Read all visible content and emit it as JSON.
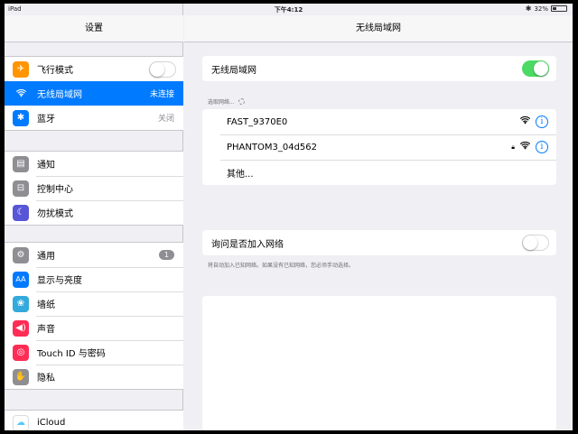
{
  "status_bar": {
    "carrier": "iPad",
    "time": "下午4:12",
    "battery": "32%",
    "battery_level": 0.32
  },
  "sidebar": {
    "title": "设置",
    "group1": [
      {
        "label": "飞行模式",
        "icon": "airplane-icon",
        "color": "#ff9500",
        "toggle": false
      },
      {
        "label": "无线局域网",
        "icon": "wifi-icon",
        "color": "#007aff",
        "value": "未连接",
        "selected": true
      },
      {
        "label": "蓝牙",
        "icon": "bluetooth-icon",
        "color": "#007aff",
        "value": "关闭"
      }
    ],
    "group2": [
      {
        "label": "通知",
        "icon": "notifications-icon",
        "color": "#8e8e93"
      },
      {
        "label": "控制中心",
        "icon": "control-center-icon",
        "color": "#8e8e93"
      },
      {
        "label": "勿扰模式",
        "icon": "moon-icon",
        "color": "#5856d6"
      }
    ],
    "group3": [
      {
        "label": "通用",
        "icon": "gear-icon",
        "color": "#8e8e93",
        "badge": "1"
      },
      {
        "label": "显示与亮度",
        "icon": "display-icon",
        "color": "#007aff"
      },
      {
        "label": "墙纸",
        "icon": "wallpaper-icon",
        "color": "#34aadc"
      },
      {
        "label": "声音",
        "icon": "sound-icon",
        "color": "#ff2d55"
      },
      {
        "label": "Touch ID 与密码",
        "icon": "fingerprint-icon",
        "color": "#ff2d55"
      },
      {
        "label": "隐私",
        "icon": "hand-icon",
        "color": "#8e8e93"
      }
    ],
    "group4": [
      {
        "label": "iCloud",
        "icon": "cloud-icon",
        "color": "#ffffff"
      }
    ]
  },
  "main": {
    "title": "无线局域网",
    "wifi_toggle_label": "无线局域网",
    "wifi_on": true,
    "choose_network_label": "选取网络...",
    "networks": [
      {
        "name": "FAST_9370E0",
        "locked": false
      },
      {
        "name": "PHANTOM3_04d562",
        "locked": true
      }
    ],
    "other_label": "其他...",
    "ask_join_label": "询问是否加入网络",
    "ask_join_on": false,
    "ask_join_footnote": "将自动加入已知网络。如果没有已知网络，您必须手动选择。"
  },
  "colors": {
    "accent": "#007aff",
    "toggle_on": "#4cd964"
  }
}
